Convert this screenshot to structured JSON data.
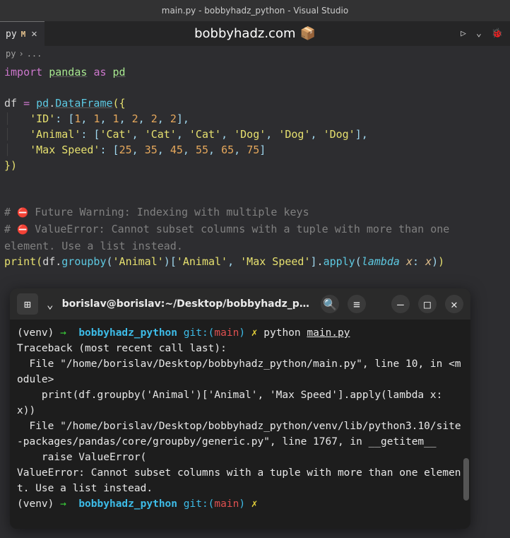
{
  "titlebar": "main.py - bobbyhadz_python - Visual Studio",
  "tab": {
    "label": "py",
    "modified": "M",
    "close": "✕"
  },
  "overlay": {
    "text": "bobbyhadz.com",
    "icon": "📦"
  },
  "run": {
    "play": "▷",
    "chev": "⌄",
    "bug": "🐞"
  },
  "breadcrumb": {
    "p1": "py",
    "sep": "›",
    "p2": "..."
  },
  "code": {
    "import": "import",
    "pandas": "pandas",
    "as": "as",
    "pd": "pd",
    "df": "df",
    "eq": "=",
    "pdref": "pd",
    "dot": ".",
    "dataframe": "DataFrame",
    "lparen": "(",
    "rparen": ")",
    "lbrace": "{",
    "rbrace": "}",
    "lbrack": "[",
    "rbrack": "]",
    "comma": ",",
    "colon": ":",
    "id_key": "'ID'",
    "n1": "1",
    "n2": "2",
    "animal_key": "'Animal'",
    "cat": "'Cat'",
    "dog": "'Dog'",
    "speed_key": "'Max Speed'",
    "s25": "25",
    "s35": "35",
    "s45": "45",
    "s55": "55",
    "s65": "65",
    "s75": "75",
    "hash": "#",
    "emoji": "⛔",
    "c1": " Future Warning: Indexing with multiple keys",
    "c2": " ValueError: Cannot subset columns with a tuple with more than one",
    "c3": "element. Use a list instead.",
    "print": "print",
    "groupby": "groupby",
    "apply": "apply",
    "animal_str": "'Animal'",
    "speed_str": "'Max Speed'",
    "lambda": "lambda",
    "x": "x"
  },
  "term": {
    "newTab": "⊞",
    "chev": "⌄",
    "title": "borislav@borislav:~/Desktop/bobbyhadz_pyt…",
    "search": "🔍",
    "menu": "≡",
    "min": "–",
    "max": "□",
    "close": "✕",
    "venv": "(venv)",
    "arrow": "→",
    "dir": "bobbyhadz_python",
    "git": "git:(",
    "branch": "main",
    "gitc": ")",
    "flash": "✗",
    "cmd": "python",
    "file": "main.py",
    "out": "Traceback (most recent call last):\n  File \"/home/borislav/Desktop/bobbyhadz_python/main.py\", line 10, in <module>\n    print(df.groupby('Animal')['Animal', 'Max Speed'].apply(lambda x: x))\n  File \"/home/borislav/Desktop/bobbyhadz_python/venv/lib/python3.10/site-packages/pandas/core/groupby/generic.py\", line 1767, in __getitem__\n    raise ValueError(\nValueError: Cannot subset columns with a tuple with more than one element. Use a list instead."
  }
}
